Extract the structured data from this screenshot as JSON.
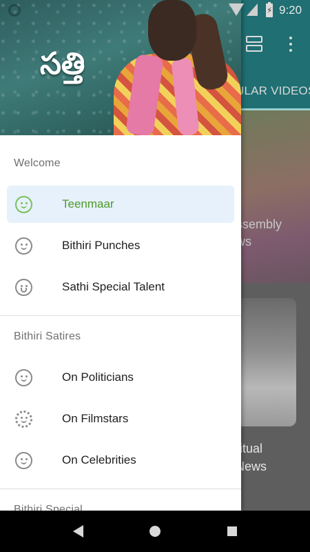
{
  "status_bar": {
    "time": "9:20",
    "icons": [
      "settings-icon",
      "wifi-icon",
      "signal-icon",
      "battery-charging-icon"
    ]
  },
  "app": {
    "tab_label": "ULAR VIDEOS",
    "toolbar_icons": [
      "view-toggle-icon",
      "overflow-menu-icon"
    ],
    "cards": [
      {
        "title_line1": "ssembly",
        "title_line2": "ws"
      },
      {
        "title_line1": "ritual",
        "title_line2": "News"
      }
    ]
  },
  "drawer": {
    "header_title": "సత్తి",
    "sections": [
      {
        "title": "Welcome",
        "items": [
          {
            "label": "Teenmaar",
            "icon": "wink-face-icon",
            "selected": true
          },
          {
            "label": "Bithiri Punches",
            "icon": "smile-face-icon",
            "selected": false
          },
          {
            "label": "Sathi Special Talent",
            "icon": "grin-face-icon",
            "selected": false
          }
        ]
      },
      {
        "title": "Bithiri Satires",
        "items": [
          {
            "label": "On Politicians",
            "icon": "tongue-face-icon",
            "selected": false
          },
          {
            "label": "On Filmstars",
            "icon": "flower-face-icon",
            "selected": false
          },
          {
            "label": "On Celebrities",
            "icon": "happy-face-icon",
            "selected": false
          }
        ]
      },
      {
        "title": "Bithiri Special",
        "items": []
      }
    ],
    "colors": {
      "selected_background": "#e6f1fb",
      "selected_text": "#4e9a2a",
      "header_teal": "#2e5d5e"
    }
  },
  "nav_bar": {
    "buttons": [
      "back-icon",
      "home-icon",
      "recents-icon"
    ]
  }
}
